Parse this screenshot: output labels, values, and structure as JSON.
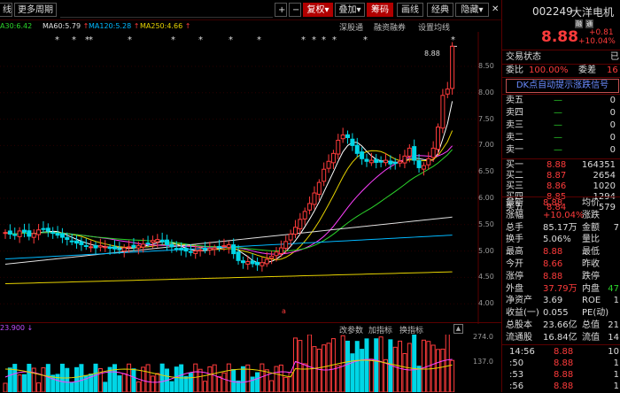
{
  "toolbar": {
    "left_items": [
      "线",
      "更多周期"
    ],
    "plus": "+",
    "minus": "−",
    "fq_label": "复权",
    "overlay_label": "叠加",
    "chip_label": "筹码",
    "draw_label": "画线",
    "classic_label": "经典",
    "hide_label": "隐藏",
    "close_label": "✕"
  },
  "ma_legend": [
    {
      "label": "A30:6.42",
      "color": "#2bd42b"
    },
    {
      "label": "MA60:5.79",
      "color": "#e0e0e0"
    },
    {
      "label": "MA120:5.28",
      "color": "#00b8ff"
    },
    {
      "label": "MA250:4.66",
      "color": "#e6d200"
    }
  ],
  "chart_tabs": [
    "深股通",
    "融资融券",
    "设置均线"
  ],
  "price_axis": [
    "8.50",
    "8.00",
    "7.50",
    "7.00",
    "6.50",
    "6.00",
    "5.50",
    "5.00",
    "4.50",
    "4.00"
  ],
  "last_price_tag": "8.88",
  "star_marks": [
    "*",
    "*",
    "*",
    "*",
    "*",
    "*",
    "*",
    "*",
    "*",
    "*",
    "*",
    "*",
    "*",
    "*",
    "*"
  ],
  "event_mark": "a",
  "volume": {
    "left_label": "23.900",
    "tabs": [
      "改参数",
      "加指标",
      "换指标"
    ],
    "axis": [
      "274.0",
      "137.0"
    ]
  },
  "quote": {
    "code": "002249",
    "name": "大洋电机",
    "badges": [
      "融",
      "通"
    ],
    "price": "8.88",
    "change": "+0.81",
    "change_pct": "+10.04%",
    "trade_status_label": "交易状态",
    "trade_status_value": "已",
    "weibi_label": "委比",
    "weibi_value": "100.00%",
    "weicha_label": "委差",
    "weicha_value": "16",
    "signal_banner": "DK点自动提示涨跌信号",
    "asks": [
      {
        "label": "卖五",
        "price": "—",
        "vol": "0"
      },
      {
        "label": "卖四",
        "price": "—",
        "vol": "0"
      },
      {
        "label": "卖三",
        "price": "—",
        "vol": "0"
      },
      {
        "label": "卖二",
        "price": "—",
        "vol": "0"
      },
      {
        "label": "卖一",
        "price": "—",
        "vol": "0"
      }
    ],
    "bids": [
      {
        "label": "买一",
        "price": "8.88",
        "vol": "164351"
      },
      {
        "label": "买二",
        "price": "8.87",
        "vol": "2654"
      },
      {
        "label": "买三",
        "price": "8.86",
        "vol": "1020"
      },
      {
        "label": "买四",
        "price": "8.85",
        "vol": "1294"
      },
      {
        "label": "买五",
        "price": "8.84",
        "vol": "579"
      }
    ],
    "stats": [
      {
        "l1": "最新",
        "v1": "8.88",
        "c1": "r",
        "l2": "均价",
        "v2": "",
        "c2": "w"
      },
      {
        "l1": "涨幅",
        "v1": "+10.04%",
        "c1": "r",
        "l2": "涨跌",
        "v2": "",
        "c2": "r"
      },
      {
        "l1": "总手",
        "v1": "85.17万",
        "c1": "w",
        "l2": "金额",
        "v2": "7",
        "c2": "w"
      },
      {
        "l1": "换手",
        "v1": "5.06%",
        "c1": "w",
        "l2": "量比",
        "v2": "",
        "c2": "w"
      },
      {
        "l1": "最高",
        "v1": "8.88",
        "c1": "r",
        "l2": "最低",
        "v2": "",
        "c2": "g"
      },
      {
        "l1": "今开",
        "v1": "8.66",
        "c1": "r",
        "l2": "昨收",
        "v2": "",
        "c2": "w"
      },
      {
        "l1": "涨停",
        "v1": "8.88",
        "c1": "r",
        "l2": "跌停",
        "v2": "",
        "c2": "g"
      },
      {
        "l1": "外盘",
        "v1": "37.79万",
        "c1": "r",
        "l2": "内盘",
        "v2": "47",
        "c2": "g"
      },
      {
        "l1": "净资产",
        "v1": "3.69",
        "c1": "w",
        "l2": "ROE",
        "v2": "1",
        "c2": "w"
      },
      {
        "l1": "收益(一)",
        "v1": "0.055",
        "c1": "w",
        "l2": "PE(动)",
        "v2": "",
        "c2": "w"
      },
      {
        "l1": "总股本",
        "v1": "23.66亿",
        "c1": "w",
        "l2": "总值",
        "v2": "21",
        "c2": "w"
      },
      {
        "l1": "流通股",
        "v1": "16.84亿",
        "c1": "w",
        "l2": "流值",
        "v2": "14",
        "c2": "w"
      }
    ],
    "ticks": [
      {
        "time": "14:56",
        "price": "8.88",
        "vol": "10"
      },
      {
        "time": ":50",
        "price": "8.88",
        "vol": "1"
      },
      {
        "time": ":53",
        "price": "8.88",
        "vol": "1"
      },
      {
        "time": ":56",
        "price": "8.88",
        "vol": "1"
      }
    ]
  },
  "colors": {
    "up": "#ff3b3b",
    "down": "#00d6e6",
    "accent": "#b10000"
  }
}
